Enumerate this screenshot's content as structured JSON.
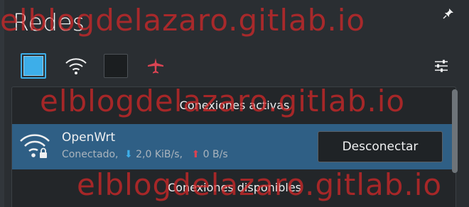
{
  "header": {
    "title": "Redes",
    "pin_icon": "pin-icon"
  },
  "toolbar": {
    "buttons": [
      {
        "name": "wired",
        "icon": "wired-network-icon",
        "state": "checked"
      },
      {
        "name": "wifi",
        "icon": "wifi-icon"
      },
      {
        "name": "mobile",
        "icon": "mobile-broadband-icon",
        "state": "unchecked"
      },
      {
        "name": "airplane",
        "icon": "airplane-mode-icon"
      },
      {
        "name": "configure",
        "icon": "configure-icon"
      }
    ]
  },
  "sections": {
    "active_title": "Conexiones activas",
    "available_title": "Conexiones disponibles"
  },
  "connection": {
    "name": "OpenWrt",
    "status": "Conectado,",
    "download_arrow": "⬇",
    "download": "2,0 KiB/s,",
    "upload_arrow": "⬆",
    "upload": "0 B/s",
    "icon": "wifi-secured-icon",
    "button_label": "Desconectar"
  },
  "watermark": "elblogdelazaro.gitlab.io",
  "colors": {
    "accent": "#3daee9",
    "selected_row": "#2f5f85",
    "watermark": "#da2828",
    "airplane": "#da4453"
  }
}
